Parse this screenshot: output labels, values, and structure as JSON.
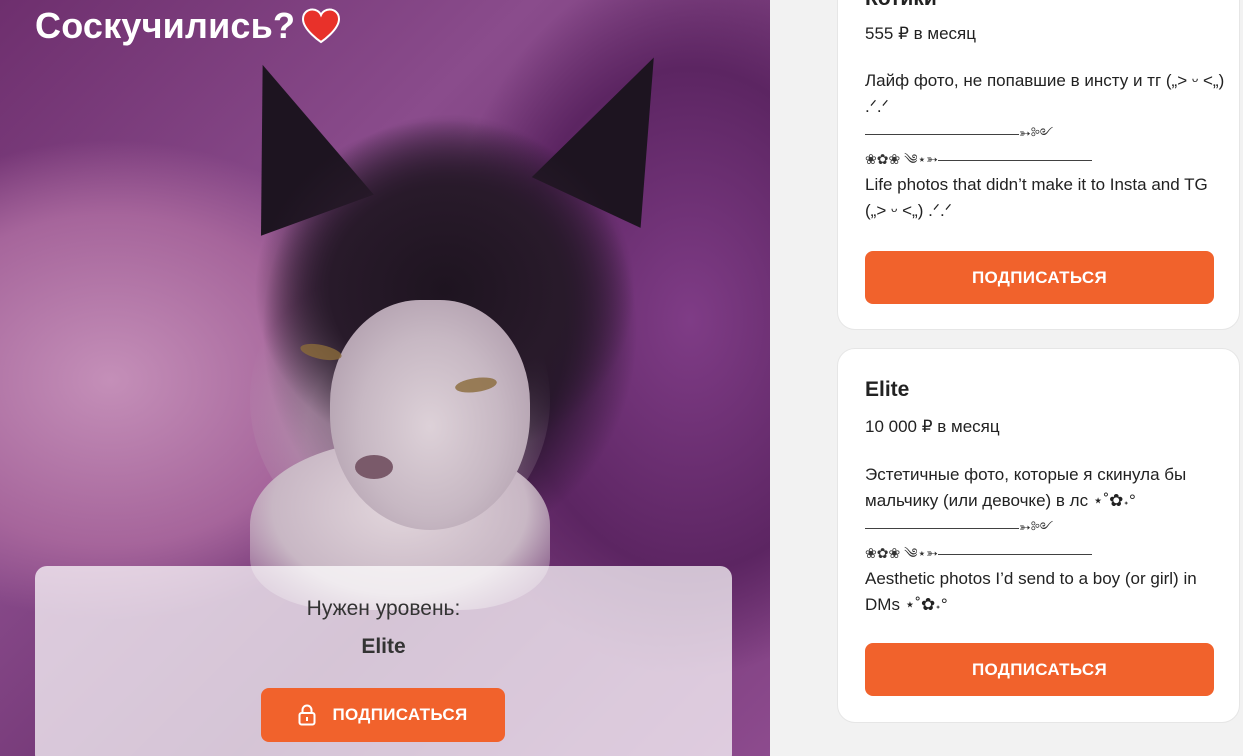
{
  "post": {
    "title": "Соскучились?",
    "heart_icon": "heart-icon",
    "lock_panel": {
      "need_label": "Нужен уровень:",
      "level_name": "Elite",
      "button_label": "ПОДПИСАТЬСЯ",
      "button_icon": "lock-icon"
    }
  },
  "tiers": [
    {
      "name": "Котики",
      "price": "555 ₽ в месяц",
      "desc_ru": "Лайф фото, не попавшие в инсту и тг („> ᵕ <„) .ᐟ.ᐟ",
      "deco_1": "———————————➳༻",
      "deco_2": "❀✿❀ ༄⋆➳———————————",
      "desc_en": "Life photos that didn’t make it to Insta and TG („> ᵕ <„) .ᐟ.ᐟ",
      "button_label": "ПОДПИСАТЬСЯ"
    },
    {
      "name": "Elite",
      "price": "10 000 ₽ в месяц",
      "desc_ru": "Эстетичные фото, которые я скинула бы мальчику (или девочке) в лс ⋆˚✿˖°",
      "deco_1": "———————————➳༻",
      "deco_2": "❀✿❀ ༄⋆➳———————————",
      "desc_en": "Aesthetic photos I’d send to a boy (or girl) in DMs ⋆˚✿˖°",
      "button_label": "ПОДПИСАТЬСЯ"
    }
  ],
  "colors": {
    "accent": "#f1622c",
    "heart": "#e8312a",
    "card_bg": "#ffffff",
    "page_bg": "#f2f2f2"
  }
}
